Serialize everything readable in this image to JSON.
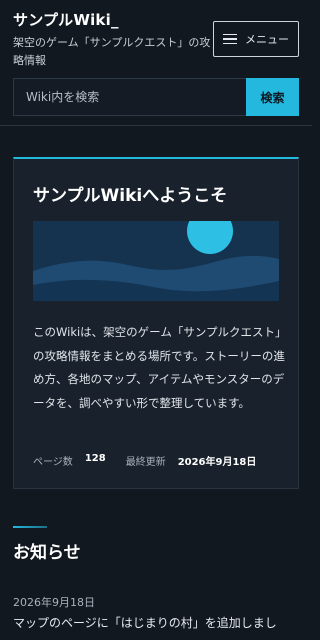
{
  "header": {
    "site_title": "サンプルWiki_",
    "subtitle": "架空のゲーム「サンプルクエスト」の攻略情報",
    "menu_label": "メニュー"
  },
  "search": {
    "placeholder": "Wiki内を検索",
    "button_label": "検索"
  },
  "welcome": {
    "title": "サンプルWikiへようこそ",
    "body": "このWikiは、架空のゲーム「サンプルクエスト」の攻略情報をまとめる場所です。ストーリーの進め方、各地のマップ、アイテムやモンスターのデータを、調べやすい形で整理しています。",
    "page_count_label": "ページ数",
    "page_count_value": "128",
    "updated_label": "最終更新",
    "updated_value": "2026年9月18日"
  },
  "news": {
    "heading": "お知らせ",
    "items": [
      {
        "date": "2026年9月18日",
        "text": "マップのページに「はじまりの村」を追加しまし"
      }
    ]
  },
  "colors": {
    "accent": "#25b8de",
    "background": "#121820",
    "card": "#18212c"
  },
  "icons": {
    "menu": "hamburger-icon"
  }
}
